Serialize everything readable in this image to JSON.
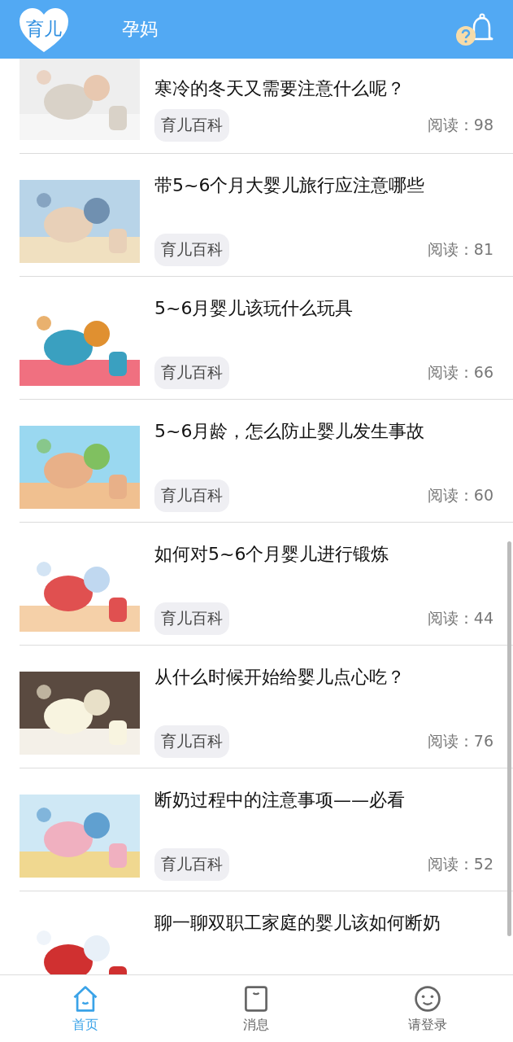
{
  "header": {
    "tabs": [
      {
        "label": "育儿",
        "selected": true
      },
      {
        "label": "孕妈",
        "selected": false
      }
    ]
  },
  "articles": [
    {
      "title": "寒冷的冬天又需要注意什么呢？",
      "tag": "育儿百科",
      "reads": "阅读：98"
    },
    {
      "title": "带5~6个月大婴儿旅行应注意哪些",
      "tag": "育儿百科",
      "reads": "阅读：81"
    },
    {
      "title": "5~6月婴儿该玩什么玩具",
      "tag": "育儿百科",
      "reads": "阅读：66"
    },
    {
      "title": "5~6月龄，怎么防止婴儿发生事故",
      "tag": "育儿百科",
      "reads": "阅读：60"
    },
    {
      "title": "如何对5~6个月婴儿进行锻炼",
      "tag": "育儿百科",
      "reads": "阅读：44"
    },
    {
      "title": "从什么时候开始给婴儿点心吃？",
      "tag": "育儿百科",
      "reads": "阅读：76"
    },
    {
      "title": "断奶过程中的注意事项——必看",
      "tag": "育儿百科",
      "reads": "阅读：52"
    },
    {
      "title": "聊一聊双职工家庭的婴儿该如何断奶"
    }
  ],
  "nav": [
    {
      "label": "首页",
      "selected": true
    },
    {
      "label": "消息",
      "selected": false
    },
    {
      "label": "请登录",
      "selected": false
    }
  ]
}
